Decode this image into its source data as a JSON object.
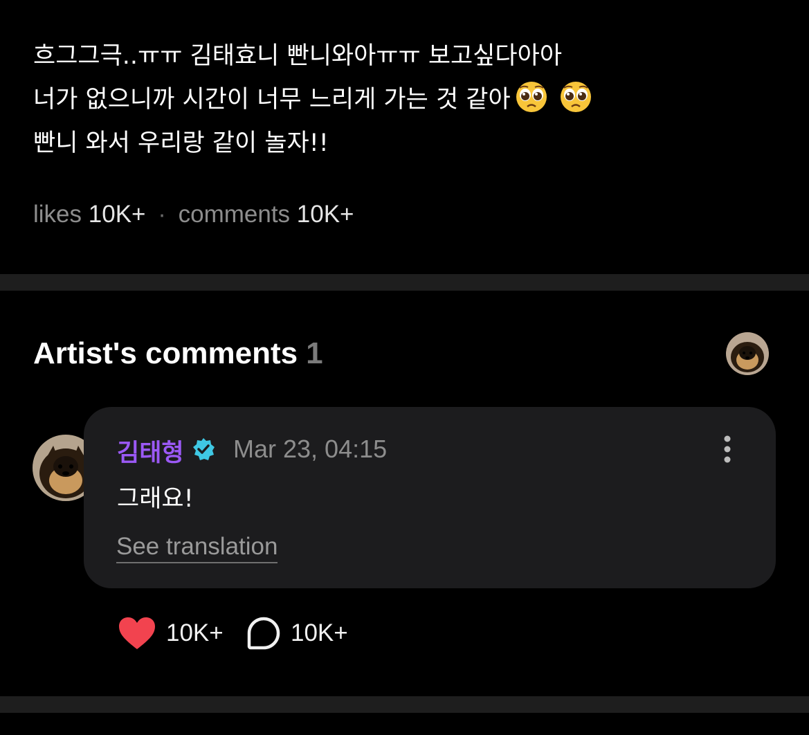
{
  "post": {
    "lines": [
      "흐그그극..ㅠㅠ 김태효니 빤니와아ㅠㅠ 보고싶다아아",
      "너가 없으니까 시간이 너무 느리게 가는 것 같아",
      "빤니 와서 우리랑 같이 놀자!!"
    ],
    "emojis": [
      "pleading-face",
      "pleading-face"
    ],
    "likes_label": "likes",
    "likes_count": "10K+",
    "separator": "·",
    "comments_label": "comments",
    "comments_count": "10K+"
  },
  "artist_comments": {
    "title": "Artist's comments",
    "count": "1",
    "comment": {
      "author": "김태형",
      "verified": true,
      "timestamp": "Mar 23, 04:15",
      "text": "그래요!",
      "translate_label": "See translation",
      "likes": "10K+",
      "replies": "10K+"
    }
  },
  "colors": {
    "background": "#000000",
    "divider": "#1e1e1e",
    "card": "#1c1c1e",
    "author": "#9b59f5",
    "verified_badge": "#3fc8e4",
    "heart": "#f2434f",
    "muted": "#8d8d8d"
  }
}
